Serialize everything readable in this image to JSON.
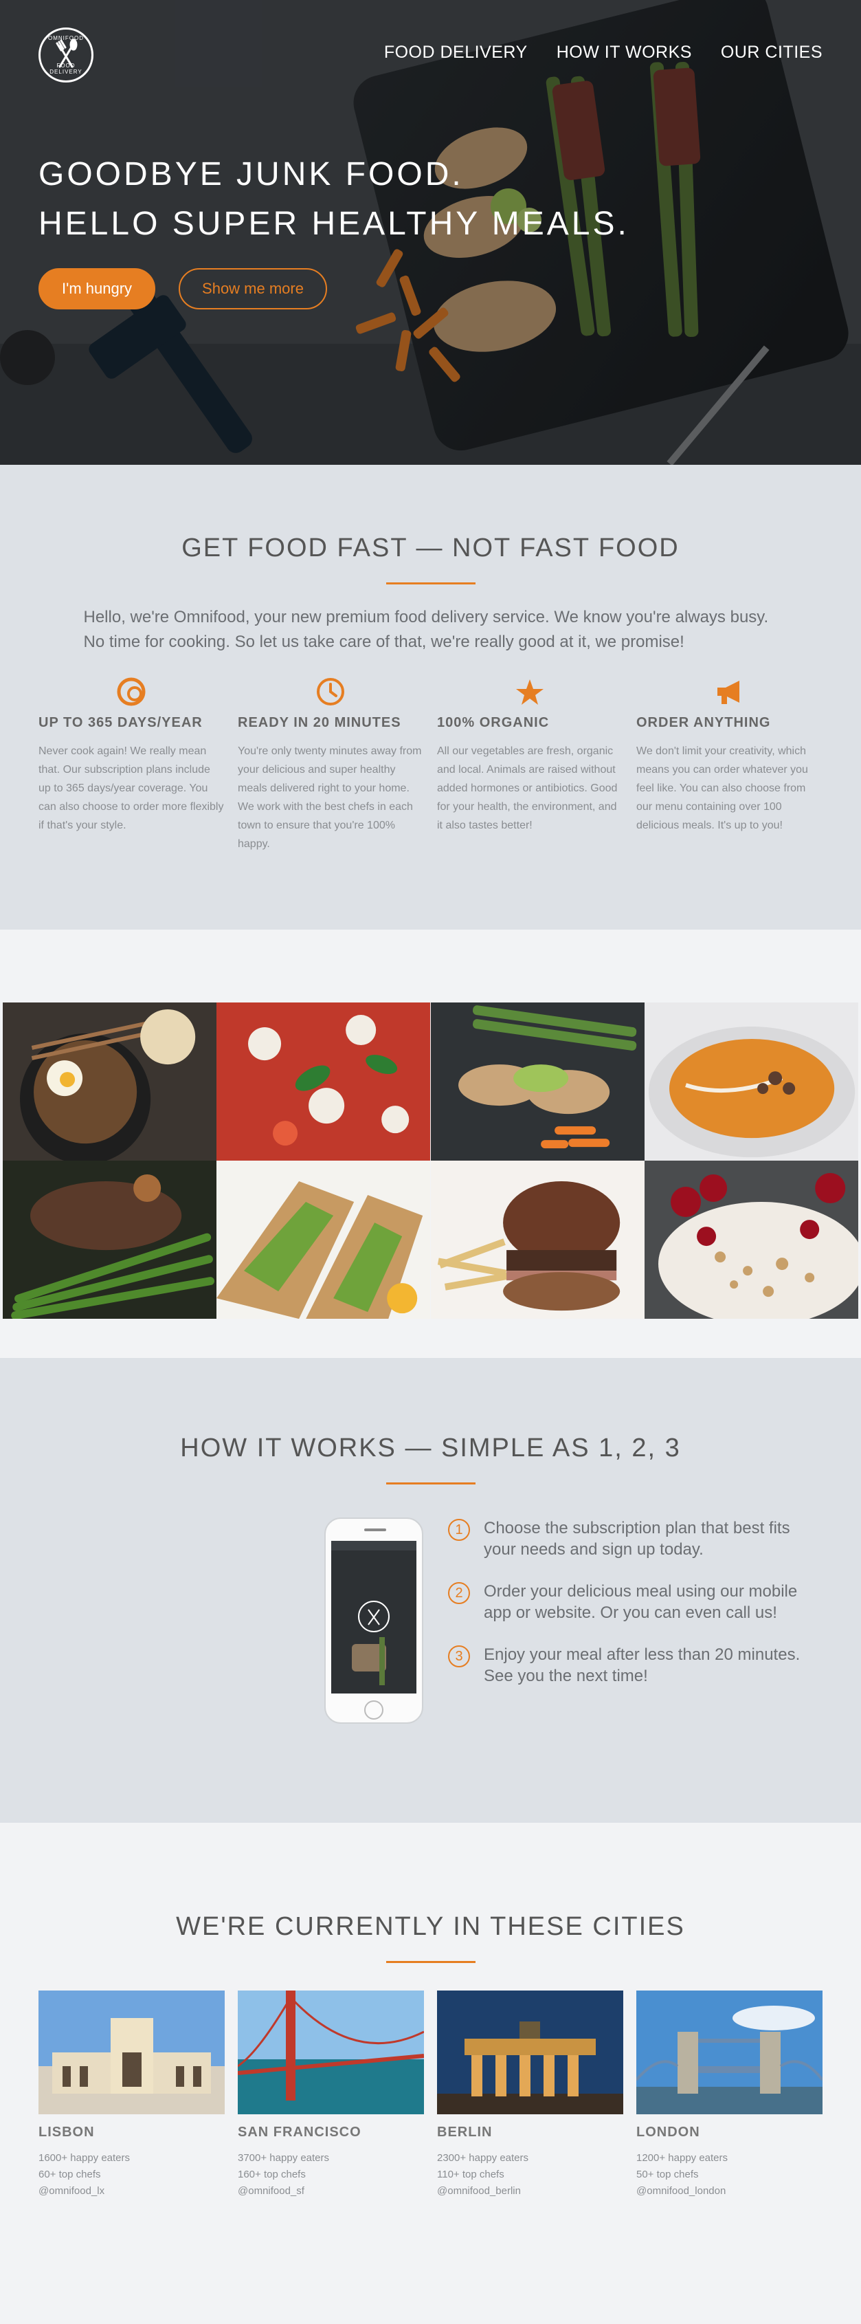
{
  "header": {
    "logo_top": "OMNIFOOD",
    "logo_bottom": "FOOD DELIVERY",
    "nav": [
      "FOOD DELIVERY",
      "HOW IT WORKS",
      "OUR CITIES"
    ],
    "title_line_1": "GOODBYE JUNK FOOD.",
    "title_line_2": "HELLO SUPER HEALTHY MEALS.",
    "cta_primary": "I'm hungry",
    "cta_secondary": "Show me more"
  },
  "features": {
    "title": "GET FOOD FAST — NOT FAST FOOD",
    "intro": "Hello, we're Omnifood, your new premium food delivery service. We know you're always busy. No time for cooking. So let us take care of that, we're really good at it, we promise!",
    "items": [
      {
        "icon": "infinity-circle-icon",
        "title": "UP TO 365 DAYS/YEAR",
        "text": "Never cook again! We really mean that. Our subscription plans include up to 365 days/year coverage. You can also choose to order more flexibly if that's your style."
      },
      {
        "icon": "stopwatch-icon",
        "title": "READY IN 20 MINUTES",
        "text": "You're only twenty minutes away from your delicious and super healthy meals delivered right to your home. We work with the best chefs in each town to ensure that you're 100% happy."
      },
      {
        "icon": "leaf-star-icon",
        "title": "100% ORGANIC",
        "text": "All our vegetables are fresh, organic and local. Animals are raised without added hormones or antibiotics. Good for your health, the environment, and it also tastes better!"
      },
      {
        "icon": "megaphone-icon",
        "title": "ORDER ANYTHING",
        "text": "We don't limit your creativity, which means you can order whatever you feel like. You can also choose from our menu containing over 100 delicious meals. It's up to you!"
      }
    ]
  },
  "how": {
    "title": "HOW IT WORKS — SIMPLE AS 1, 2, 3",
    "steps": [
      {
        "num": "1",
        "text": "Choose the subscription plan that best fits your needs and sign up today."
      },
      {
        "num": "2",
        "text": "Order your delicious meal using our mobile app or website. Or you can even call us!"
      },
      {
        "num": "3",
        "text": "Enjoy your meal after less than 20 minutes. See you the next time!"
      }
    ]
  },
  "cities": {
    "title": "WE'RE CURRENTLY IN THESE CITIES",
    "items": [
      {
        "name": "LISBON",
        "eaters": "1600+ happy eaters",
        "chefs": "60+ top chefs",
        "handle": "@omnifood_lx"
      },
      {
        "name": "SAN FRANCISCO",
        "eaters": "3700+ happy eaters",
        "chefs": "160+ top chefs",
        "handle": "@omnifood_sf"
      },
      {
        "name": "BERLIN",
        "eaters": "2300+ happy eaters",
        "chefs": "110+ top chefs",
        "handle": "@omnifood_berlin"
      },
      {
        "name": "LONDON",
        "eaters": "1200+ happy eaters",
        "chefs": "50+ top chefs",
        "handle": "@omnifood_london"
      }
    ]
  },
  "colors": {
    "accent": "#e67e22",
    "section_grey": "#dde1e6",
    "section_light": "#f2f3f5",
    "text": "#555555"
  }
}
